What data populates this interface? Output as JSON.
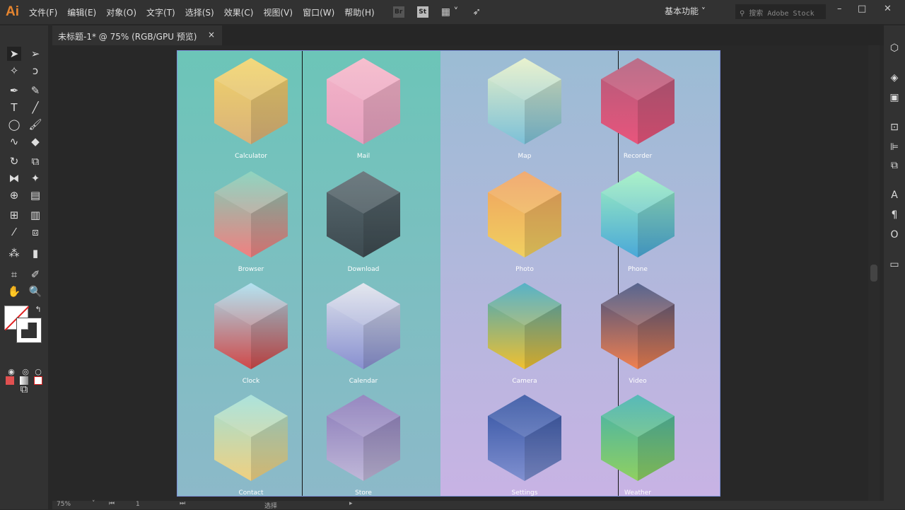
{
  "app": {
    "logo": "Ai",
    "menus": [
      "文件(F)",
      "编辑(E)",
      "对象(O)",
      "文字(T)",
      "选择(S)",
      "效果(C)",
      "视图(V)",
      "窗口(W)",
      "帮助(H)"
    ],
    "bridge": "Br",
    "stock": "St",
    "workspace": "基本功能",
    "search_placeholder": "搜索 Adobe Stock"
  },
  "document": {
    "tab_title": "未标题-1* @ 75% (RGB/GPU 预览)",
    "close": "×"
  },
  "status": {
    "zoom": "75%",
    "artboard": "1",
    "tool": "选择"
  },
  "colors": {
    "accent": "#e6852f",
    "left_bg": "#6cc5b8",
    "right_bg": "#c8b3e4"
  },
  "apps": [
    {
      "label": "Calculator",
      "top": "#f1d46a",
      "bottom": "#d9b27a"
    },
    {
      "label": "Mail",
      "top": "#f5b6c8",
      "bottom": "#e6a0c0"
    },
    {
      "label": "Map",
      "top": "#e6f0c8",
      "bottom": "#7cc0d8"
    },
    {
      "label": "Recorder",
      "top": "#b05c7a",
      "bottom": "#e8557c"
    },
    {
      "label": "Browser",
      "top": "#7fcfb8",
      "bottom": "#f08080"
    },
    {
      "label": "Download",
      "top": "#5a6a70",
      "bottom": "#3d4a50"
    },
    {
      "label": "Photo",
      "top": "#f0a060",
      "bottom": "#f0d060"
    },
    {
      "label": "Phone",
      "top": "#a0f0c0",
      "bottom": "#4aa8d8"
    },
    {
      "label": "Clock",
      "top": "#a8e0f0",
      "bottom": "#d04848"
    },
    {
      "label": "Calendar",
      "top": "#e0e4ec",
      "bottom": "#8890d0"
    },
    {
      "label": "Camera",
      "top": "#40a8c0",
      "bottom": "#f0c030"
    },
    {
      "label": "Video",
      "top": "#405080",
      "bottom": "#f08050"
    },
    {
      "label": "Contact",
      "top": "#a0e0d8",
      "bottom": "#f0d080"
    },
    {
      "label": "Store",
      "top": "#8878b8",
      "bottom": "#c0b8d8"
    },
    {
      "label": "Settings",
      "top": "#3050a0",
      "bottom": "#8090d0"
    },
    {
      "label": "Weather",
      "top": "#40b0b0",
      "bottom": "#90d060"
    }
  ]
}
